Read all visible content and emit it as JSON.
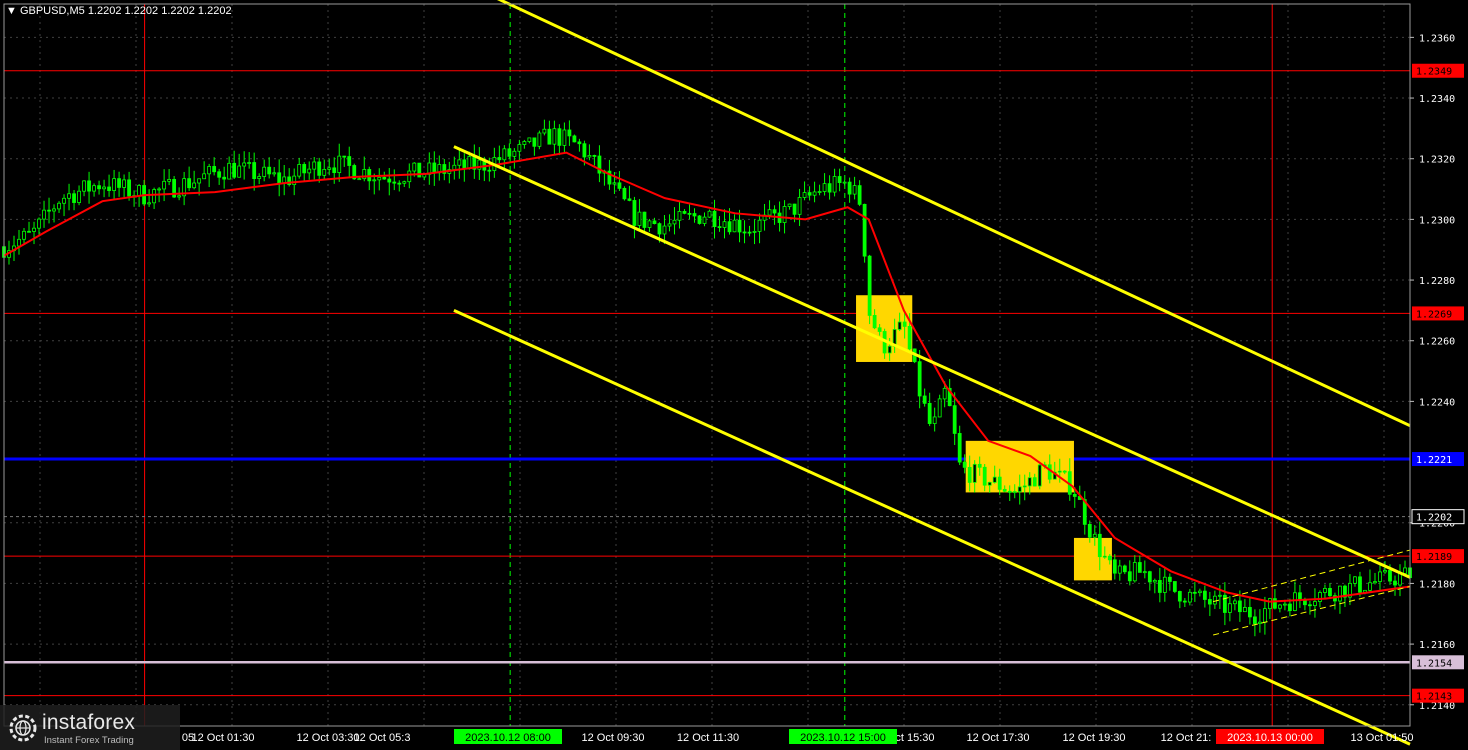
{
  "window": {
    "symbol": "GBPUSD,M5",
    "ohlc": "1.2202 1.2202 1.2202 1.2202"
  },
  "colors": {
    "background": "#000000",
    "candle": "#00ff00",
    "moving_average": "#ff0000",
    "channel": "#ffff00",
    "level_line": "#ff0000",
    "key_level": "#0000ff",
    "support_level": "#d8bfd8",
    "signal_box": "#ffd700",
    "grid": "#404040"
  },
  "logo": {
    "name": "instaforex",
    "tagline": "Instant Forex Trading",
    "icon": "gear-globe-icon"
  },
  "chart_data": {
    "type": "candlestick",
    "price_axis": {
      "range": [
        1.2133,
        1.2371
      ],
      "ticks": [
        "1.2360",
        "1.2340",
        "1.2320",
        "1.2300",
        "1.2280",
        "1.2260",
        "1.2240",
        "1.2200",
        "1.2180",
        "1.2160",
        "1.2140"
      ]
    },
    "time_axis": {
      "ticks": [
        "12 Oct 01:30",
        "12 Oct 03:30",
        "12 Oct 09:30",
        "12 Oct 11:30",
        "12 Oct 15:30",
        "12 Oct 17:30",
        "12 Oct 19:30",
        "13 Oct 01:50"
      ],
      "partial_labels": [
        "05",
        "12 Oct 05:3",
        "12 Oct 13",
        "12 Oct 21:"
      ],
      "highlighted": [
        {
          "label": "2023.10.12 08:00",
          "color": "#00ff00"
        },
        {
          "label": "2023.10.12 15:00",
          "color": "#00ff00"
        },
        {
          "label": "2023.10.13 00:00",
          "color": "#ff0000"
        }
      ]
    },
    "price_levels": [
      {
        "price": 1.2349,
        "label": "1.2349",
        "color": "#ff0000"
      },
      {
        "price": 1.2269,
        "label": "1.2269",
        "color": "#ff0000"
      },
      {
        "price": 1.2221,
        "label": "1.2221",
        "color": "#0000ff"
      },
      {
        "price": 1.2202,
        "label": "1.2202",
        "color": "#ffffff"
      },
      {
        "price": 1.2189,
        "label": "1.2189",
        "color": "#ff0000"
      },
      {
        "price": 1.2154,
        "label": "1.2154",
        "color": "#d8bfd8"
      },
      {
        "price": 1.2143,
        "label": "1.2143",
        "color": "#ff0000"
      }
    ],
    "close_path": [
      [
        0,
        1.2291
      ],
      [
        0.02,
        1.2295
      ],
      [
        0.04,
        1.2307
      ],
      [
        0.07,
        1.2312
      ],
      [
        0.1,
        1.2308
      ],
      [
        0.13,
        1.2312
      ],
      [
        0.16,
        1.2317
      ],
      [
        0.2,
        1.2313
      ],
      [
        0.23,
        1.2319
      ],
      [
        0.27,
        1.2314
      ],
      [
        0.31,
        1.2316
      ],
      [
        0.34,
        1.2318
      ],
      [
        0.37,
        1.2323
      ],
      [
        0.39,
        1.2328
      ],
      [
        0.41,
        1.2324
      ],
      [
        0.43,
        1.2312
      ],
      [
        0.45,
        1.23
      ],
      [
        0.47,
        1.2298
      ],
      [
        0.5,
        1.2302
      ],
      [
        0.53,
        1.2297
      ],
      [
        0.56,
        1.2303
      ],
      [
        0.58,
        1.231
      ],
      [
        0.6,
        1.2312
      ],
      [
        0.61,
        1.2305
      ],
      [
        0.615,
        1.227
      ],
      [
        0.625,
        1.2258
      ],
      [
        0.64,
        1.2265
      ],
      [
        0.65,
        1.2245
      ],
      [
        0.66,
        1.223
      ],
      [
        0.67,
        1.2244
      ],
      [
        0.68,
        1.2218
      ],
      [
        0.7,
        1.2214
      ],
      [
        0.72,
        1.221
      ],
      [
        0.74,
        1.2218
      ],
      [
        0.76,
        1.2212
      ],
      [
        0.775,
        1.2195
      ],
      [
        0.79,
        1.2182
      ],
      [
        0.81,
        1.2184
      ],
      [
        0.83,
        1.2178
      ],
      [
        0.85,
        1.2175
      ],
      [
        0.87,
        1.2172
      ],
      [
        0.89,
        1.217
      ],
      [
        0.91,
        1.2174
      ],
      [
        0.93,
        1.2176
      ],
      [
        0.96,
        1.2179
      ],
      [
        0.98,
        1.2181
      ],
      [
        1.0,
        1.2183
      ]
    ],
    "ma_path": [
      [
        0,
        1.2288
      ],
      [
        0.03,
        1.2296
      ],
      [
        0.07,
        1.2306
      ],
      [
        0.1,
        1.2308
      ],
      [
        0.15,
        1.2309
      ],
      [
        0.2,
        1.2312
      ],
      [
        0.25,
        1.2314
      ],
      [
        0.3,
        1.2315
      ],
      [
        0.35,
        1.2318
      ],
      [
        0.4,
        1.2322
      ],
      [
        0.43,
        1.2315
      ],
      [
        0.47,
        1.2307
      ],
      [
        0.52,
        1.2302
      ],
      [
        0.57,
        1.23
      ],
      [
        0.6,
        1.2304
      ],
      [
        0.615,
        1.23
      ],
      [
        0.64,
        1.227
      ],
      [
        0.67,
        1.2245
      ],
      [
        0.7,
        1.2227
      ],
      [
        0.73,
        1.2222
      ],
      [
        0.76,
        1.2212
      ],
      [
        0.79,
        1.2195
      ],
      [
        0.83,
        1.2184
      ],
      [
        0.87,
        1.2177
      ],
      [
        0.9,
        1.2174
      ],
      [
        0.94,
        1.2175
      ],
      [
        1.0,
        1.2179
      ]
    ],
    "channel_lines": [
      {
        "from": [
          0.35,
          1.2373
        ],
        "to": [
          1.0,
          1.2232
        ]
      },
      {
        "from": [
          0.32,
          1.2324
        ],
        "to": [
          1.0,
          1.2182
        ]
      },
      {
        "from": [
          0.32,
          1.227
        ],
        "to": [
          1.0,
          1.2127
        ]
      }
    ],
    "mini_channel": [
      {
        "from": [
          0.86,
          1.2174
        ],
        "to": [
          1.0,
          1.2191
        ]
      },
      {
        "from": [
          0.86,
          1.2163
        ],
        "to": [
          1.0,
          1.2179
        ]
      }
    ],
    "signal_boxes": [
      {
        "t0": 0.606,
        "t1": 0.646,
        "high": 1.2275,
        "low": 1.2253
      },
      {
        "t0": 0.684,
        "t1": 0.761,
        "high": 1.2227,
        "low": 1.221
      },
      {
        "t0": 0.761,
        "t1": 0.788,
        "high": 1.2195,
        "low": 1.2181
      }
    ],
    "vertical_markers": [
      {
        "t": 0.1,
        "color": "#ff0000",
        "style": "solid"
      },
      {
        "t": 0.36,
        "color": "#00ff00",
        "style": "dashed"
      },
      {
        "t": 0.598,
        "color": "#00ff00",
        "style": "dashed"
      },
      {
        "t": 0.902,
        "color": "#ff0000",
        "style": "solid"
      }
    ]
  }
}
